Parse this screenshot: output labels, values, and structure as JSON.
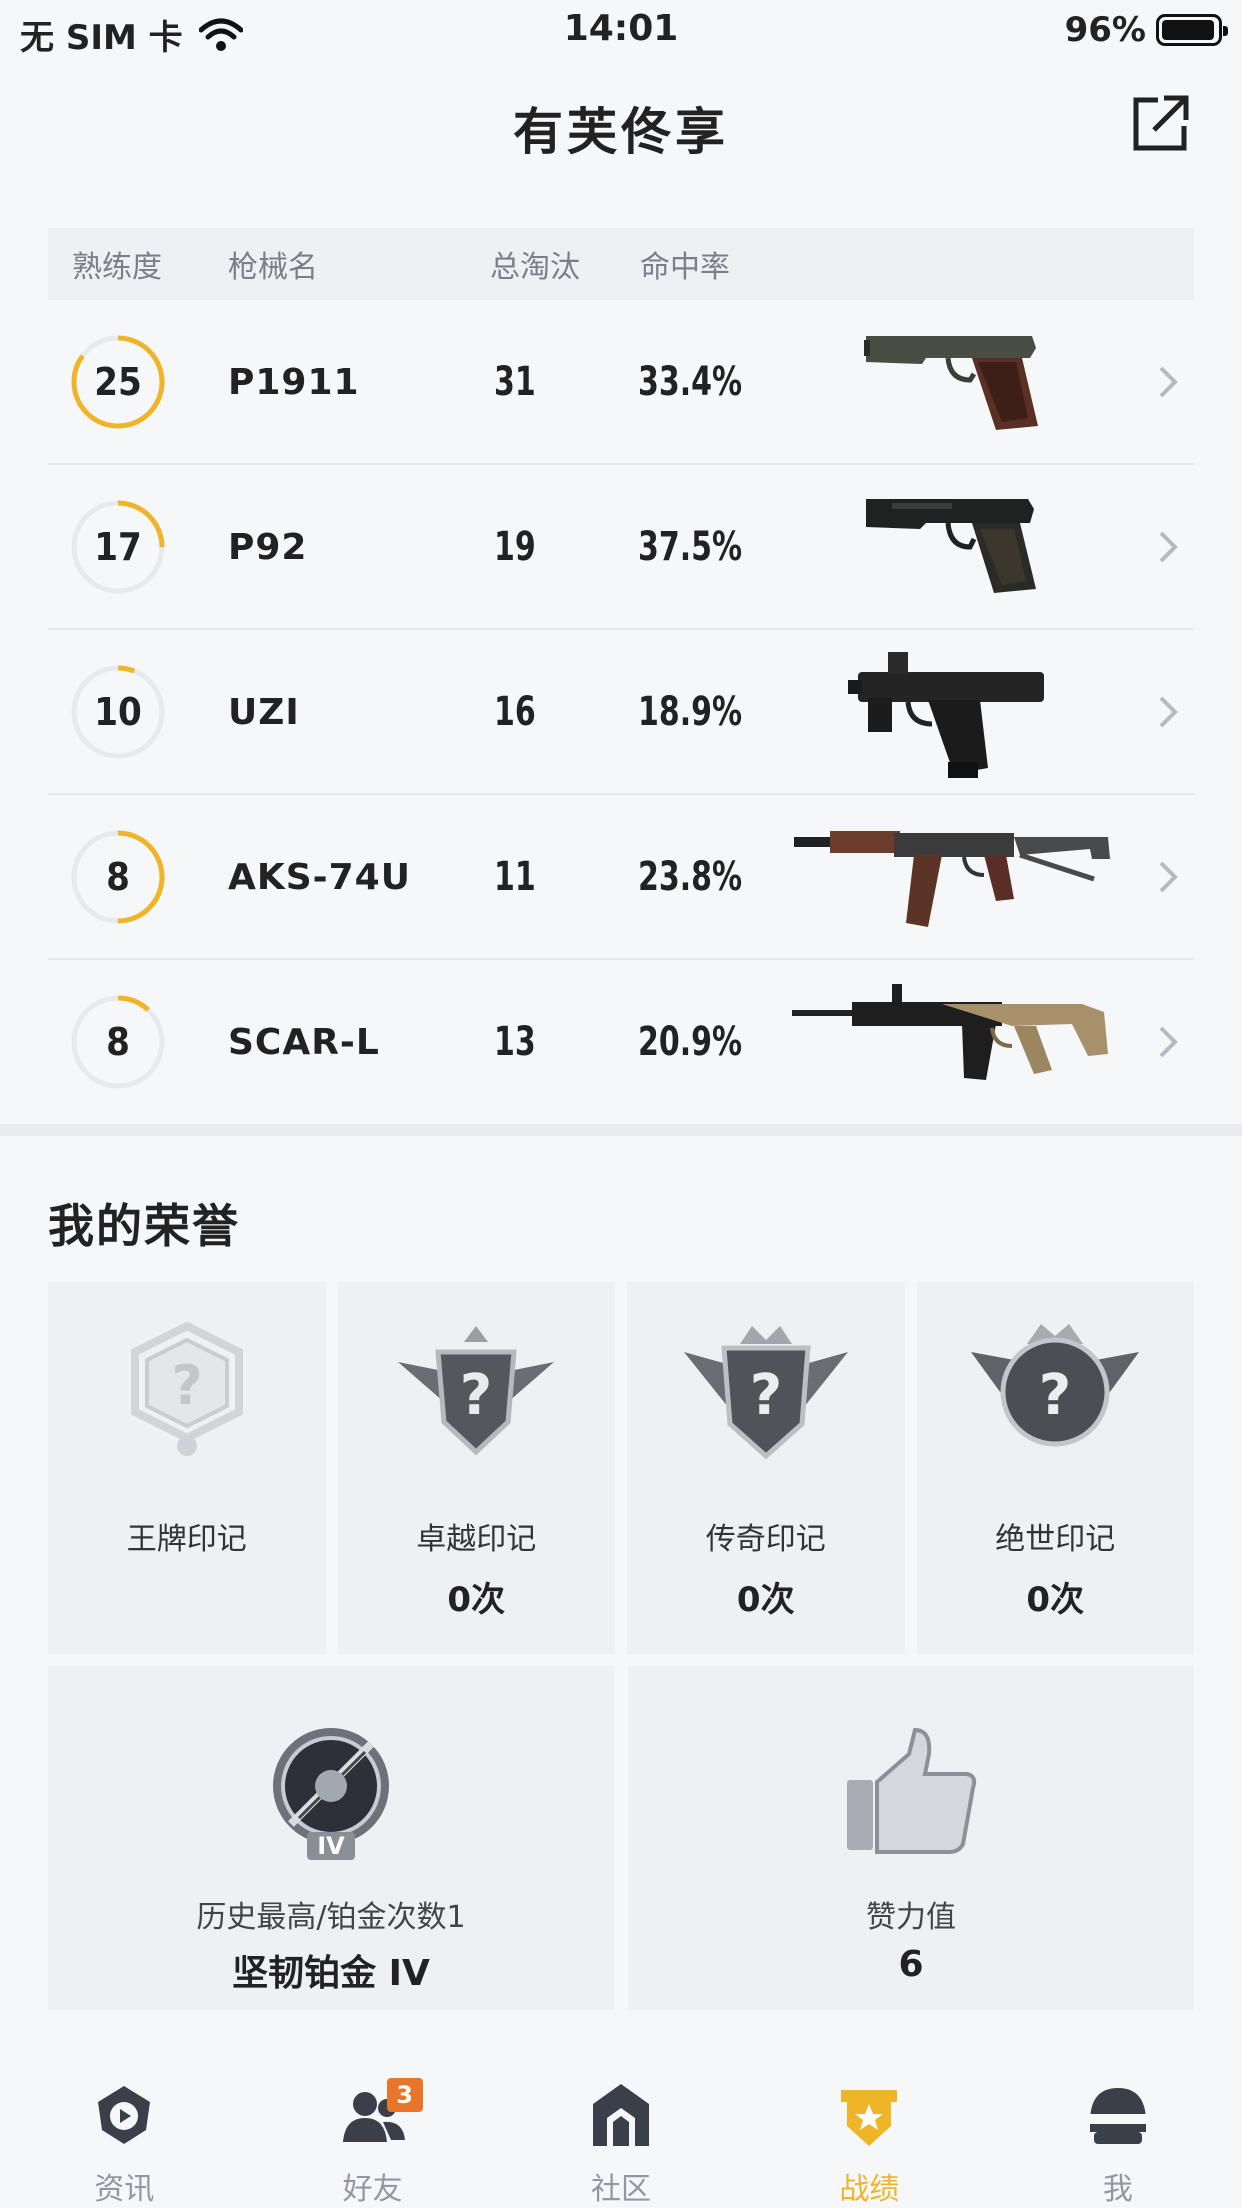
{
  "status_bar": {
    "carrier": "无 SIM 卡",
    "time": "14:01",
    "battery": "96%",
    "battery_level": 0.96
  },
  "header": {
    "title": "有芙佟享"
  },
  "weapon_table": {
    "columns": [
      "熟练度",
      "枪械名",
      "总淘汰",
      "命中率"
    ],
    "rows": [
      {
        "proficiency": "25",
        "proficiency_fill": 0.85,
        "name": "P1911",
        "kills": "31",
        "hit_rate": "33.4%",
        "image": "p1911-pistol-image"
      },
      {
        "proficiency": "17",
        "proficiency_fill": 0.25,
        "name": "P92",
        "kills": "19",
        "hit_rate": "37.5%",
        "image": "p92-pistol-image"
      },
      {
        "proficiency": "10",
        "proficiency_fill": 0.06,
        "name": "UZI",
        "kills": "16",
        "hit_rate": "18.9%",
        "image": "uzi-smg-image"
      },
      {
        "proficiency": "8",
        "proficiency_fill": 0.5,
        "name": "AKS-74U",
        "kills": "11",
        "hit_rate": "23.8%",
        "image": "aks74u-rifle-image"
      },
      {
        "proficiency": "8",
        "proficiency_fill": 0.12,
        "name": "SCAR-L",
        "kills": "13",
        "hit_rate": "20.9%",
        "image": "scarl-rifle-image"
      }
    ]
  },
  "honors": {
    "title": "我的荣誉",
    "badges": [
      {
        "name": "王牌印记",
        "count": ""
      },
      {
        "name": "卓越印记",
        "count": "0次"
      },
      {
        "name": "传奇印记",
        "count": "0次"
      },
      {
        "name": "绝世印记",
        "count": "0次"
      }
    ],
    "tier": {
      "label": "历史最高/铂金次数1",
      "value": "坚韧铂金 IV",
      "emblem_text": "IV"
    },
    "likes": {
      "label": "赞力值",
      "value": "6"
    }
  },
  "tabbar": {
    "tabs": [
      {
        "label": "资讯",
        "icon": "news-icon"
      },
      {
        "label": "好友",
        "icon": "friends-icon",
        "badge": "3"
      },
      {
        "label": "社区",
        "icon": "community-icon"
      },
      {
        "label": "战绩",
        "icon": "record-icon",
        "active": true
      },
      {
        "label": "我",
        "icon": "profile-helmet-icon"
      }
    ]
  },
  "colors": {
    "accent": "#f0b428",
    "ring_track": "#e8e9ec",
    "badge": "#e8762a",
    "text": "#222222",
    "muted": "#7a7f88"
  }
}
